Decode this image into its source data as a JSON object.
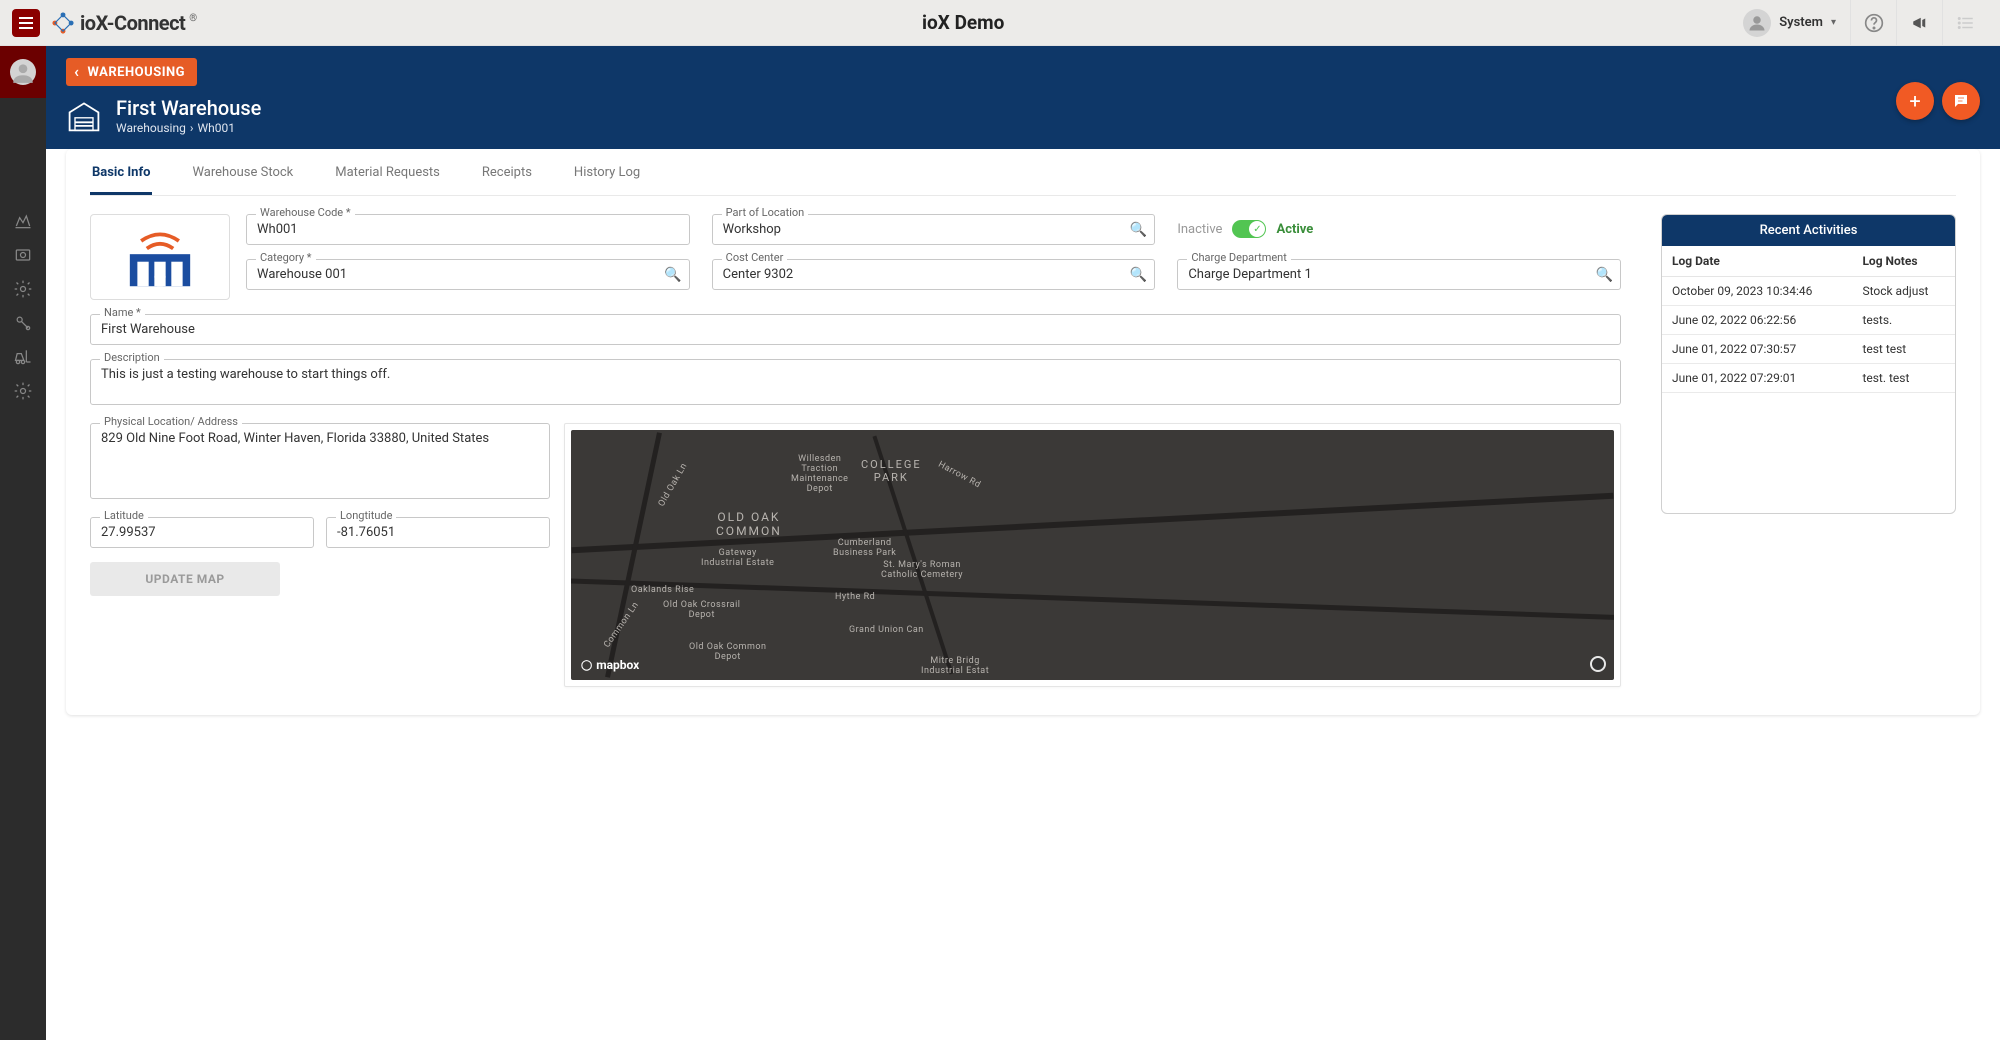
{
  "brand": "ioX-Connect",
  "app_title": "ioX Demo",
  "user": {
    "name": "System"
  },
  "header": {
    "back_label": "WAREHOUSING",
    "title": "First Warehouse",
    "breadcrumb": {
      "module": "Warehousing",
      "code": "Wh001"
    }
  },
  "tabs": [
    {
      "label": "Basic Info",
      "active": true
    },
    {
      "label": "Warehouse Stock"
    },
    {
      "label": "Material Requests"
    },
    {
      "label": "Receipts"
    },
    {
      "label": "History Log"
    }
  ],
  "form": {
    "warehouse_code": {
      "label": "Warehouse Code *",
      "value": "Wh001"
    },
    "part_of_location": {
      "label": "Part of Location",
      "value": "Workshop"
    },
    "status": {
      "inactive_label": "Inactive",
      "active_label": "Active"
    },
    "category": {
      "label": "Category *",
      "value": "Warehouse 001"
    },
    "cost_center": {
      "label": "Cost Center",
      "value": "Center 9302"
    },
    "charge_department": {
      "label": "Charge Department",
      "value": "Charge Department 1"
    },
    "name": {
      "label": "Name *",
      "value": "First Warehouse"
    },
    "description": {
      "label": "Description",
      "value": "This is just a testing warehouse to start things off."
    },
    "address": {
      "label": "Physical Location/ Address",
      "value": "829 Old Nine Foot Road, Winter Haven, Florida 33880, United States"
    },
    "latitude": {
      "label": "Latitude",
      "value": "27.99537"
    },
    "longitude": {
      "label": "Longtitude",
      "value": "-81.76051"
    },
    "update_map_button": "UPDATE MAP"
  },
  "map": {
    "attrib": "mapbox",
    "places": {
      "old_oak_common": "OLD OAK\nCOMMON",
      "college_park": "COLLEGE\nPARK",
      "willesden": "Willesden\nTraction\nMaintenance\nDepot",
      "gateway": "Gateway\nIndustrial Estate",
      "cumberland": "Cumberland\nBusiness Park",
      "stmary": "St. Mary's Roman\nCatholic Cemetery",
      "oaklands": "Oaklands Rise",
      "crossrail": "Old Oak Crossrail\nDepot",
      "common_depot": "Old Oak Common\nDepot",
      "hythe": "Hythe Rd",
      "grand_union": "Grand Union Can",
      "mitre": "Mitre Bridg\nIndustrial Estat",
      "harrow": "Harrow Rd",
      "oldoak_ln": "Old Oak Ln",
      "common_ln": "Common Ln"
    }
  },
  "activities": {
    "title": "Recent Activities",
    "columns": {
      "date": "Log Date",
      "notes": "Log Notes"
    },
    "rows": [
      {
        "date": "October 09, 2023 10:34:46",
        "notes": "Stock adjust"
      },
      {
        "date": "June 02, 2022 06:22:56",
        "notes": "tests."
      },
      {
        "date": "June 01, 2022 07:30:57",
        "notes": "test test"
      },
      {
        "date": "June 01, 2022 07:29:01",
        "notes": "test. test"
      }
    ]
  }
}
